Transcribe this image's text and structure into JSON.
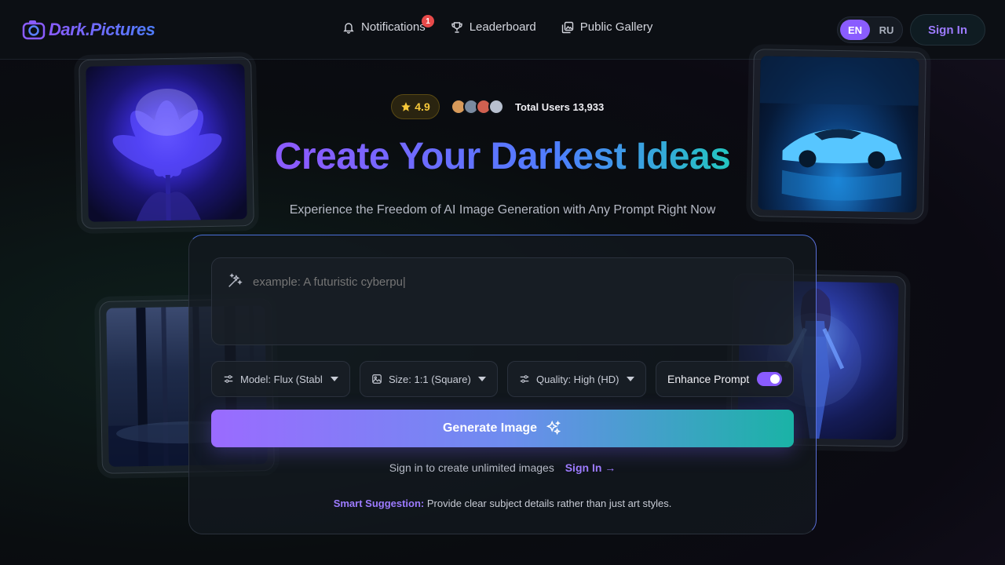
{
  "header": {
    "logo_text": "Dark.Pictures",
    "nav": [
      {
        "label": "Notifications",
        "icon": "bell-icon",
        "badge": "1"
      },
      {
        "label": "Leaderboard",
        "icon": "trophy-icon"
      },
      {
        "label": "Public Gallery",
        "icon": "gallery-icon"
      }
    ],
    "lang": {
      "en": "EN",
      "ru": "RU",
      "active": "EN"
    },
    "signin_label": "Sign In"
  },
  "hero": {
    "rating": "4.9",
    "total_users": "Total Users 13,933",
    "title": "Create Your Darkest Ideas",
    "subtitle": "Experience the Freedom of AI Image Generation with Any Prompt Right Now"
  },
  "generator": {
    "prompt_placeholder": "example: A futuristic cyberpu|",
    "model": "Model: Flux (Stabl",
    "size": "Size: 1:1 (Square)",
    "quality": "Quality: High (HD)",
    "enhance_label": "Enhance Prompt",
    "enhance_on": true,
    "generate_label": "Generate Image",
    "signin_text": "Sign in to create unlimited images",
    "signin_link": "Sign In",
    "suggestion_label": "Smart Suggestion:",
    "suggestion_text": " Provide clear subject details rather than just art styles."
  },
  "colors": {
    "accent": "#8a5cff",
    "teal": "#1ab3a6",
    "star": "#f6c83a",
    "badge": "#e84a4a"
  }
}
